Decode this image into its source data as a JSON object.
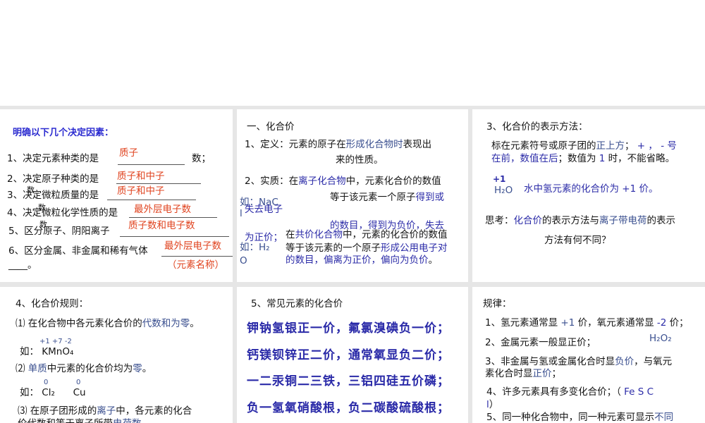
{
  "panel1": {
    "title": "明确以下几个决定因素：",
    "lines": [
      {
        "label": "1、决定元素种类的是",
        "answer": "质子",
        "suffix": "数；"
      },
      {
        "label": "2、决定原子种类的是",
        "answer": "质子和中子"
      },
      {
        "label": "3、决定微粒质量的是",
        "answer": "质子和中子"
      },
      {
        "label": "4、决定微粒化学性质的是",
        "answer": "最外层电子数"
      },
      {
        "label": "5、区分原子、阴阳离子",
        "answer": "质子数和电子数"
      },
      {
        "label": "6、区分金属、非金属和稀有气体",
        "answer": "最外层电子数"
      }
    ],
    "overlap_char": "数",
    "tail": "____。",
    "note": "（元素名称）"
  },
  "panel2": {
    "heading": "一、化合价",
    "def": [
      {
        "t": "1、定义：元素的原子在",
        "c": "black"
      },
      {
        "t": "形成化合物时",
        "c": "blue"
      },
      {
        "t": "表现出",
        "c": "black"
      }
    ],
    "def2": [
      {
        "t": "来的性质。",
        "c": "black"
      }
    ],
    "ess1": [
      {
        "t": "2、实质：在",
        "c": "black"
      },
      {
        "t": "离子化合物",
        "c": "dblue"
      },
      {
        "t": "中，元素化合价的数值",
        "c": "black"
      }
    ],
    "ess2": [
      {
        "t": "等于该元素一个原子",
        "c": "black"
      },
      {
        "t": "得到或",
        "c": "dblue"
      }
    ],
    "ess3": [
      {
        "t": "失去电子",
        "c": "dblue"
      }
    ],
    "ess4": [
      {
        "t": "的数目，得到为负价，失去",
        "c": "dblue"
      }
    ],
    "ess5": [
      {
        "t": "为正价；",
        "c": "dblue"
      }
    ],
    "example1a": "如：NaC",
    "example1b": "l",
    "cov1": [
      {
        "t": "在",
        "c": "black"
      },
      {
        "t": "共价化合物",
        "c": "dblue"
      },
      {
        "t": "中，元素的化合价的数值",
        "c": "black"
      }
    ],
    "cov2": [
      {
        "t": "等于该元素的一个原子",
        "c": "black"
      },
      {
        "t": "形成公用电子对",
        "c": "dblue"
      }
    ],
    "cov3": [
      {
        "t": "的数目，偏离为正价，偏向为负价",
        "c": "dblue"
      },
      {
        "t": "。",
        "c": "black"
      }
    ],
    "example2a": "如：H₂",
    "example2b": "O"
  },
  "panel3": {
    "heading": "3、化合价的表示方法：",
    "l1": [
      {
        "t": "标在元素符号或原子团的",
        "c": "black"
      },
      {
        "t": "正上方",
        "c": "blue"
      },
      {
        "t": "； ",
        "c": "black"
      },
      {
        "t": "+ ， - 号",
        "c": "dblue"
      }
    ],
    "l2": [
      {
        "t": "在前，数值在后",
        "c": "dblue"
      },
      {
        "t": "；数值为 ",
        "c": "black"
      },
      {
        "t": "1",
        "c": "dblue"
      },
      {
        "t": " 时，不能省略。",
        "c": "black"
      }
    ],
    "charge": "+1",
    "formula": "H₂O",
    "formula_note": "水中氢元素的化合价为 +1 价。",
    "think1": [
      {
        "t": "思考：",
        "c": "black"
      },
      {
        "t": "化合价",
        "c": "dblue"
      },
      {
        "t": "的表示方法与",
        "c": "black"
      },
      {
        "t": "离子带电荷",
        "c": "blue"
      },
      {
        "t": "的表示",
        "c": "black"
      }
    ],
    "think2": "方法有何不同？"
  },
  "panel4": {
    "heading": "4、化合价规则：",
    "r1": [
      {
        "t": "⑴ 在化合物中各元素化合价的",
        "c": "black"
      },
      {
        "t": "代数和为零",
        "c": "blue"
      },
      {
        "t": "。",
        "c": "black"
      }
    ],
    "r1_charges": "+1 +7 -2",
    "r1_example": "如： KMnO₄",
    "r2": [
      {
        "t": "⑵ ",
        "c": "black"
      },
      {
        "t": "单质",
        "c": "blue"
      },
      {
        "t": "中元素的化合价均为",
        "c": "black"
      },
      {
        "t": "零",
        "c": "blue"
      },
      {
        "t": "。",
        "c": "black"
      }
    ],
    "r2_charge1": "0",
    "r2_charge2": "0",
    "r2_example": "如： Cl₂      Cu",
    "r3": [
      {
        "t": "⑶ 在原子团形成的",
        "c": "black"
      },
      {
        "t": "离子",
        "c": "blue"
      },
      {
        "t": "中，各元素的化合",
        "c": "black"
      }
    ],
    "r3b": [
      {
        "t": "价代数和等于离子所带",
        "c": "black"
      },
      {
        "t": "电荷数",
        "c": "blue"
      }
    ]
  },
  "panel5": {
    "heading": "5、常见元素的化合价",
    "rhymes": [
      "钾钠氢银正一价，氟氯溴碘负一价；",
      "钙镁钡锌正二价，通常氧显负二价；",
      "一二汞铜二三铁，三铝四硅五价磷；",
      "负一氢氧硝酸根，负二碳酸硫酸根；"
    ]
  },
  "panel6": {
    "heading": "规律：",
    "g1": [
      {
        "t": "1、氢元素通常显 ",
        "c": "black"
      },
      {
        "t": "+1",
        "c": "blue"
      },
      {
        "t": " 价，氧元素通常显 ",
        "c": "black"
      },
      {
        "t": "-2",
        "c": "dblue"
      },
      {
        "t": " 价；",
        "c": "black"
      }
    ],
    "g2": [
      {
        "t": "2、金属元素一般显正价；",
        "c": "black"
      }
    ],
    "g2_formula": "H₂O₂",
    "g3": [
      {
        "t": "3、非金属与氢或金属化合时显",
        "c": "black"
      },
      {
        "t": "负价",
        "c": "blue"
      },
      {
        "t": "，与氧元",
        "c": "black"
      }
    ],
    "g3b": [
      {
        "t": "素化合时显",
        "c": "black"
      },
      {
        "t": "正价",
        "c": "blue"
      },
      {
        "t": "；",
        "c": "black"
      }
    ],
    "g4": [
      {
        "t": "4、许多元素具有多变化合价；（ ",
        "c": "black"
      },
      {
        "t": "Fe S C",
        "c": "dblue"
      }
    ],
    "g4b": [
      {
        "t": "l",
        "c": "dblue"
      },
      {
        "t": "）",
        "c": "black"
      }
    ],
    "g5": [
      {
        "t": "5、同一种化合物中，同一种元素可显示",
        "c": "black"
      },
      {
        "t": "不同",
        "c": "blue"
      }
    ]
  },
  "colors": {
    "black": "#141414",
    "blue": "#3a4f8f",
    "dblue": "#2c2ca8",
    "red": "#e04420"
  }
}
